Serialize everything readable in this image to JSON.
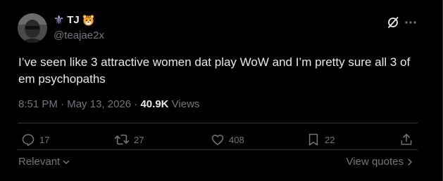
{
  "author": {
    "display_name": "TJ",
    "handle": "@teajae2x",
    "name_prefix_glyph": "⚜",
    "avatar_icon": "user-avatar-photo",
    "badge_icon": "tiger-face-emoji"
  },
  "tweet": {
    "text": "I’ve seen like 3 attractive women dat play WoW and I’m pretty sure all 3 of em psychopaths",
    "time": "8:51 PM",
    "separator": " · ",
    "date": "May 13, 2026",
    "separator2": " · ",
    "views_count": "40.9K",
    "views_label": " Views"
  },
  "actions": {
    "reply_count": "17",
    "repost_count": "27",
    "like_count": "408",
    "bookmark_count": "22"
  },
  "footer": {
    "sort_label": "Relevant",
    "quotes_label": "View quotes"
  },
  "colors": {
    "background": "#000000",
    "text_primary": "#e7e9ea",
    "text_secondary": "#71767b",
    "divider": "#2f3336",
    "fleur_accent": "#c3a7ff"
  }
}
